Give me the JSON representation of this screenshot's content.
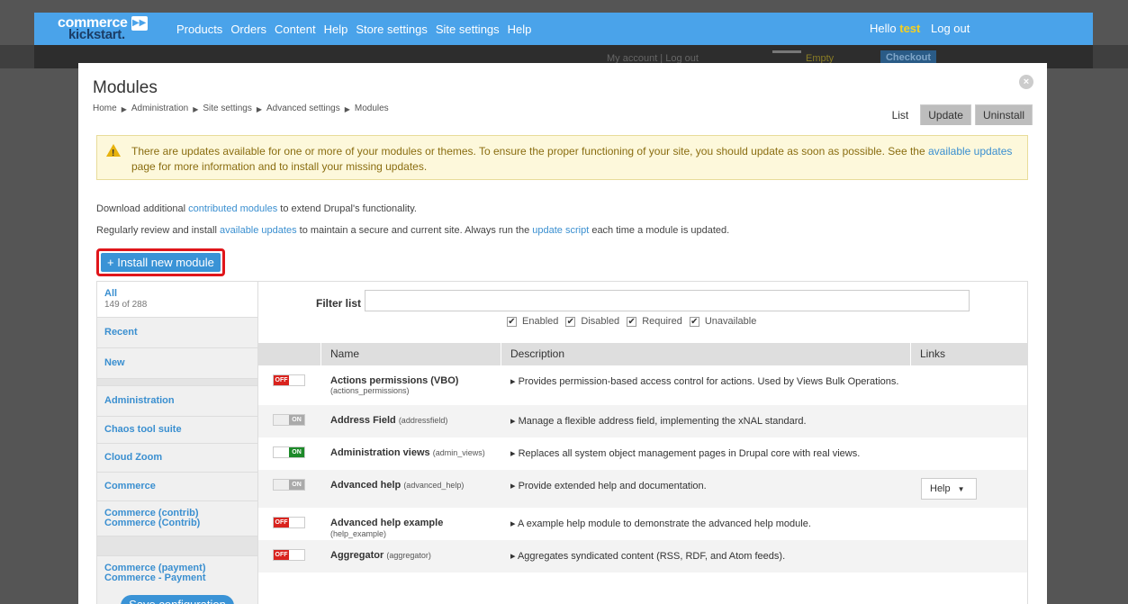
{
  "topbar": {
    "logo_line1": "commerce",
    "logo_line2": "kickstart.",
    "logo_mark": "▶▶",
    "nav": [
      "Products",
      "Orders",
      "Content",
      "Help",
      "Store settings",
      "Site settings",
      "Help"
    ],
    "greeting": "Hello",
    "username": "test",
    "logout": "Log out"
  },
  "subbar": {
    "account": "My account   |   Log out",
    "empty": "Empty",
    "checkout": "Checkout"
  },
  "modal": {
    "title": "Modules",
    "close": "×",
    "breadcrumb": [
      "Home",
      "Administration",
      "Site settings",
      "Advanced settings",
      "Modules"
    ],
    "breadcrumb_sep": "▶",
    "tabs": [
      "List",
      "Update",
      "Uninstall"
    ]
  },
  "warning": {
    "text_before": "There are updates available for one or more of your modules or themes. To ensure the proper functioning of your site, you should update as soon as possible. See the ",
    "link": "available updates",
    "text_after": " page for more information and to install your missing updates."
  },
  "help1": {
    "before": "Download additional ",
    "link": "contributed modules",
    "after": " to extend Drupal's functionality."
  },
  "help2": {
    "before": "Regularly review and install ",
    "link1": "available updates",
    "mid": " to maintain a secure and current site. Always run the ",
    "link2": "update script",
    "after": " each time a module is updated."
  },
  "install_button": "+ Install new module",
  "sidebar": {
    "all_label": "All",
    "all_count": "149 of 288",
    "items": [
      "Recent",
      "New",
      "Administration",
      "Chaos tool suite",
      "Cloud Zoom",
      "Commerce",
      "Commerce (contrib) Commerce (Contrib)",
      "Commerce (payment) Commerce - Payment"
    ],
    "save": "Save configuration"
  },
  "filter": {
    "label": "Filter list",
    "checks": [
      "Enabled",
      "Disabled",
      "Required",
      "Unavailable"
    ],
    "check_mark": "✔"
  },
  "table": {
    "headers": [
      "Name",
      "Description",
      "Links"
    ],
    "rows": [
      {
        "state": "OFF",
        "name": "Actions permissions (VBO)",
        "machine": "(actions_permissions)",
        "desc": "▸ Provides permission-based access control for actions. Used by Views Bulk Operations.",
        "link": ""
      },
      {
        "state": "ON",
        "name": "Address Field",
        "machine": "(addressfield)",
        "desc": "▸ Manage a flexible address field, implementing the xNAL standard.",
        "link": ""
      },
      {
        "state": "ON",
        "name": "Administration views",
        "machine": "(admin_views)",
        "desc": "▸ Replaces all system object management pages in Drupal core with real views.",
        "link": ""
      },
      {
        "state": "ON",
        "name": "Advanced help",
        "machine": "(advanced_help)",
        "desc": "▸ Provide extended help and documentation.",
        "link": "Help"
      },
      {
        "state": "OFF",
        "name": "Advanced help example",
        "machine": "(help_example)",
        "desc": "▸ A example help module to demonstrate the advanced help module.",
        "link": ""
      },
      {
        "state": "OFF",
        "name": "Aggregator",
        "machine": "(aggregator)",
        "desc": "▸ Aggregates syndicated content (RSS, RDF, and Atom feeds).",
        "link": ""
      }
    ]
  }
}
